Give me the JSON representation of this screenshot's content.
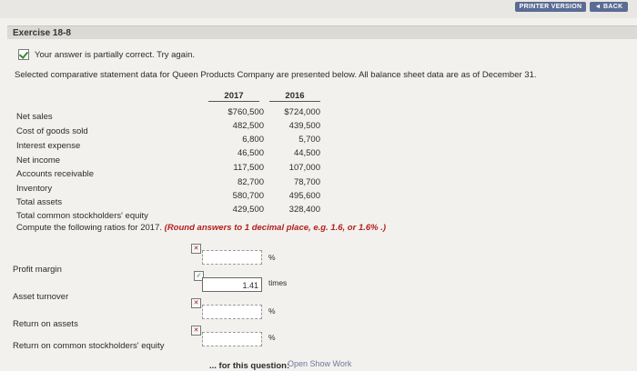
{
  "toolbar": {
    "printer_version": "PRINTER VERSION",
    "back": "◄ BACK"
  },
  "exercise": {
    "title": "Exercise 18-8",
    "status": "Your answer is partially correct.  Try again.",
    "intro": "Selected comparative statement data for Queen Products Company are presented below. All balance sheet data are as of December 31."
  },
  "table": {
    "headers": [
      "2017",
      "2016"
    ],
    "rows": [
      {
        "label": "Net sales",
        "v2017": "$760,500",
        "v2016": "$724,000"
      },
      {
        "label": "Cost of goods sold",
        "v2017": "482,500",
        "v2016": "439,500"
      },
      {
        "label": "Interest expense",
        "v2017": "6,800",
        "v2016": "5,700"
      },
      {
        "label": "Net income",
        "v2017": "46,500",
        "v2016": "44,500"
      },
      {
        "label": "Accounts receivable",
        "v2017": "117,500",
        "v2016": "107,000"
      },
      {
        "label": "Inventory",
        "v2017": "82,700",
        "v2016": "78,700"
      },
      {
        "label": "Total assets",
        "v2017": "580,700",
        "v2016": "495,600"
      },
      {
        "label": "Total common stockholders' equity",
        "v2017": "429,500",
        "v2016": "328,400"
      }
    ]
  },
  "instructions": {
    "main": "Compute the following ratios for 2017.",
    "note": "(Round answers to 1 decimal place, e.g. 1.6, or 1.6% .)"
  },
  "questions": [
    {
      "label": "Profit margin",
      "value": "",
      "unit": "%"
    },
    {
      "label": "Asset turnover",
      "value": "1.41",
      "unit": "times"
    },
    {
      "label": "Return on assets",
      "value": "",
      "unit": "%"
    },
    {
      "label": "Return on common stockholders' equity",
      "value": "",
      "unit": "%"
    }
  ],
  "footer": {
    "label": "... for this question:",
    "open_show_work": "Open Show Work"
  }
}
